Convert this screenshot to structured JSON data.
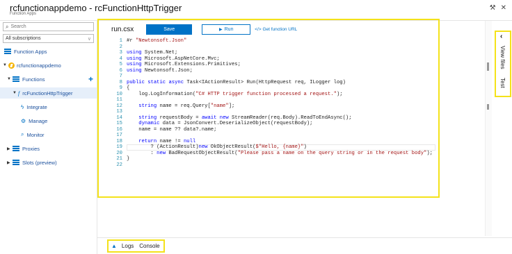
{
  "header": {
    "title": "rcfunctionappdemo - rcFunctionHttpTrigger",
    "subtitle": "Function Apps",
    "pin_icon": "pin-icon",
    "close_icon": "close-icon"
  },
  "sidebar": {
    "search_placeholder": "Search",
    "subscriptions": "All subscriptions",
    "items": [
      {
        "label": "Function Apps",
        "icon": "list-icon"
      },
      {
        "label": "rcfunctionappdemo",
        "icon": "function-app-icon"
      },
      {
        "label": "Functions",
        "icon": "list-icon"
      },
      {
        "label": "rcFunctionHttpTrigger",
        "icon": "function-icon"
      },
      {
        "label": "Integrate",
        "icon": "lightning-icon"
      },
      {
        "label": "Manage",
        "icon": "gear-icon"
      },
      {
        "label": "Monitor",
        "icon": "search-icon"
      },
      {
        "label": "Proxies",
        "icon": "list-icon"
      },
      {
        "label": "Slots (preview)",
        "icon": "list-icon"
      }
    ]
  },
  "editor": {
    "filename": "run.csx",
    "save_label": "Save",
    "run_label": "Run",
    "get_url_label": "</> Get function URL",
    "lines": [
      "#r \"Newtonsoft.Json\"",
      "",
      "using System.Net;",
      "using Microsoft.AspNetCore.Mvc;",
      "using Microsoft.Extensions.Primitives;",
      "using Newtonsoft.Json;",
      "",
      "public static async Task<IActionResult> Run(HttpRequest req, ILogger log)",
      "{",
      "    log.LogInformation(\"C# HTTP trigger function processed a request.\");",
      "",
      "    string name = req.Query[\"name\"];",
      "",
      "    string requestBody = await new StreamReader(req.Body).ReadToEndAsync();",
      "    dynamic data = JsonConvert.DeserializeObject(requestBody);",
      "    name = name ?? data?.name;",
      "",
      "    return name != null",
      "        ? (ActionResult)new OkObjectResult($\"Hello, {name}\")",
      "        : new BadRequestObjectResult(\"Please pass a name on the query string or in the request body\");",
      "}",
      ""
    ],
    "line_numbers": [
      "1",
      "2",
      "3",
      "4",
      "5",
      "6",
      "7",
      "8",
      "9",
      "10",
      "11",
      "12",
      "13",
      "14",
      "15",
      "16",
      "17",
      "18",
      "19",
      "20",
      "21",
      "22"
    ]
  },
  "side_tabs": {
    "view_files": "View files",
    "test": "Test"
  },
  "bottom": {
    "logs": "Logs",
    "console": "Console"
  },
  "colors": {
    "accent": "#0072c6",
    "highlight": "#f4e21a"
  }
}
